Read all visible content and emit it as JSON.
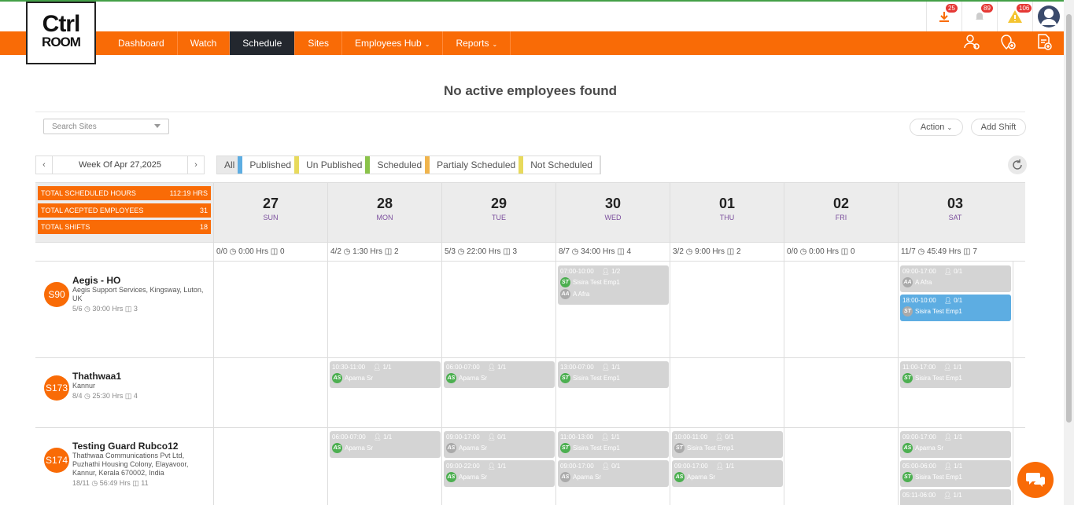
{
  "app": {
    "logo_line1": "Ctrl",
    "logo_line2": "ROOM"
  },
  "topbar": {
    "badges": {
      "download": "25",
      "bell": "89",
      "warning": "106"
    }
  },
  "nav": {
    "items": [
      "Dashboard",
      "Watch",
      "Schedule",
      "Sites",
      "Employees Hub",
      "Reports"
    ],
    "active": "Schedule"
  },
  "page": {
    "title": "No active employees found"
  },
  "search": {
    "placeholder": "Search Sites"
  },
  "buttons": {
    "action": "Action",
    "add_shift": "Add Shift"
  },
  "week": {
    "label": "Week Of Apr 27,2025"
  },
  "filters": [
    {
      "label": "All",
      "color": "#5dade2"
    },
    {
      "label": "Published",
      "color": "#e8da5c"
    },
    {
      "label": "Un Published",
      "color": "#8bc34a"
    },
    {
      "label": "Scheduled",
      "color": "#f0b44c"
    },
    {
      "label": "Partialy Scheduled",
      "color": "#e8da5c"
    },
    {
      "label": "Not Scheduled",
      "color": ""
    }
  ],
  "totals": [
    {
      "label": "TOTAL SCHEDULED HOURS",
      "value": "112:19 HRS"
    },
    {
      "label": "TOTAL ACEPTED EMPLOYEES",
      "value": "31"
    },
    {
      "label": "TOTAL SHIFTS",
      "value": "18"
    }
  ],
  "days": [
    {
      "num": "27",
      "name": "SUN",
      "sum": "0/0 ◷ 0:00 Hrs ◫ 0"
    },
    {
      "num": "28",
      "name": "MON",
      "sum": "4/2 ◷ 1:30 Hrs ◫ 2"
    },
    {
      "num": "29",
      "name": "TUE",
      "sum": "5/3 ◷ 22:00 Hrs ◫ 3"
    },
    {
      "num": "30",
      "name": "WED",
      "sum": "8/7 ◷ 34:00 Hrs ◫ 4"
    },
    {
      "num": "01",
      "name": "THU",
      "sum": "3/2 ◷ 9:00 Hrs ◫ 2"
    },
    {
      "num": "02",
      "name": "FRI",
      "sum": "0/0 ◷ 0:00 Hrs ◫ 0"
    },
    {
      "num": "03",
      "name": "SAT",
      "sum": "11/7 ◷ 45:49 Hrs ◫ 7"
    }
  ],
  "sites": [
    {
      "code": "S90",
      "name": "Aegis - HO",
      "address": "Aegis Support Services, Kingsway, Luton, UK",
      "stats": "5/6 ◷ 30:00 Hrs ◫ 3"
    },
    {
      "code": "S173",
      "name": "Thathwaa1",
      "address": "Kannur",
      "stats": "8/4 ◷ 25:30 Hrs ◫ 4"
    },
    {
      "code": "S174",
      "name": "Testing Guard Rubco12",
      "address": "Thathwaa Communications Pvt Ltd, Puzhathi Housing Colony, Elayavoor, Kannur, Kerala 670002, India",
      "stats": "18/11 ◷ 56:49 Hrs ◫ 11"
    }
  ],
  "shifts": [
    {
      "site": 0,
      "day": 3,
      "slot": 0,
      "time": "07:00-10:00",
      "count": "1/2",
      "emps": [
        {
          "i": "ST",
          "n": "Sisira Test Emp1",
          "g": false
        },
        {
          "i": "AA",
          "n": "A Afra",
          "g": true
        }
      ],
      "pub": false
    },
    {
      "site": 0,
      "day": 6,
      "slot": 0,
      "time": "09:00-17:00",
      "count": "0/1",
      "emps": [
        {
          "i": "AA",
          "n": "A Afra",
          "g": true
        }
      ],
      "pub": false
    },
    {
      "site": 0,
      "day": 6,
      "slot": 1,
      "time": "18:00-10:00",
      "count": "0/1",
      "emps": [
        {
          "i": "ST",
          "n": "Sisira Test Emp1",
          "g": true
        }
      ],
      "pub": true
    },
    {
      "site": 1,
      "day": 1,
      "slot": 0,
      "time": "10:30-11:00",
      "count": "1/1",
      "emps": [
        {
          "i": "AS",
          "n": "Aparna Sr",
          "g": false
        }
      ],
      "pub": false
    },
    {
      "site": 1,
      "day": 2,
      "slot": 0,
      "time": "06:00-07:00",
      "count": "1/1",
      "emps": [
        {
          "i": "AS",
          "n": "Aparna Sr",
          "g": false
        }
      ],
      "pub": false
    },
    {
      "site": 1,
      "day": 3,
      "slot": 0,
      "time": "13:00-07:00",
      "count": "1/1",
      "emps": [
        {
          "i": "ST",
          "n": "Sisira Test Emp1",
          "g": false
        }
      ],
      "pub": false
    },
    {
      "site": 1,
      "day": 6,
      "slot": 0,
      "time": "11:00-17:00",
      "count": "1/1",
      "emps": [
        {
          "i": "ST",
          "n": "Sisira Test Emp1",
          "g": false
        }
      ],
      "pub": false
    },
    {
      "site": 2,
      "day": 1,
      "slot": 0,
      "time": "06:00-07:00",
      "count": "1/1",
      "emps": [
        {
          "i": "AS",
          "n": "Aparna Sr",
          "g": false
        }
      ],
      "pub": false
    },
    {
      "site": 2,
      "day": 2,
      "slot": 0,
      "time": "09:00-17:00",
      "count": "0/1",
      "emps": [
        {
          "i": "AS",
          "n": "Aparna Sr",
          "g": true
        }
      ],
      "pub": false
    },
    {
      "site": 2,
      "day": 2,
      "slot": 1,
      "time": "09:00-22:00",
      "count": "1/1",
      "emps": [
        {
          "i": "AS",
          "n": "Aparna Sr",
          "g": false
        }
      ],
      "pub": false
    },
    {
      "site": 2,
      "day": 3,
      "slot": 0,
      "time": "11:00-13:00",
      "count": "1/1",
      "emps": [
        {
          "i": "ST",
          "n": "Sisira Test Emp1",
          "g": false
        }
      ],
      "pub": false
    },
    {
      "site": 2,
      "day": 3,
      "slot": 1,
      "time": "09:00-17:00",
      "count": "0/1",
      "emps": [
        {
          "i": "AS",
          "n": "Aparna Sr",
          "g": true
        }
      ],
      "pub": false
    },
    {
      "site": 2,
      "day": 4,
      "slot": 0,
      "time": "10:00-11:00",
      "count": "0/1",
      "emps": [
        {
          "i": "ST",
          "n": "Sisira Test Emp1",
          "g": true
        }
      ],
      "pub": false
    },
    {
      "site": 2,
      "day": 4,
      "slot": 1,
      "time": "09:00-17:00",
      "count": "1/1",
      "emps": [
        {
          "i": "AS",
          "n": "Aparna Sr",
          "g": false
        }
      ],
      "pub": false
    },
    {
      "site": 2,
      "day": 6,
      "slot": 0,
      "time": "09:00-17:00",
      "count": "1/1",
      "emps": [
        {
          "i": "AS",
          "n": "Aparna Sr",
          "g": false
        }
      ],
      "pub": false
    },
    {
      "site": 2,
      "day": 6,
      "slot": 1,
      "time": "05:00-06:00",
      "count": "1/1",
      "emps": [
        {
          "i": "ST",
          "n": "Sisira Test Emp1",
          "g": false
        }
      ],
      "pub": false
    },
    {
      "site": 2,
      "day": 6,
      "slot": 2,
      "time": "05:11-06:00",
      "count": "1/1",
      "emps": [],
      "pub": false
    }
  ],
  "colors": {
    "brand": "#f96b06",
    "dark": "#23272e",
    "published": "#5dade2"
  }
}
